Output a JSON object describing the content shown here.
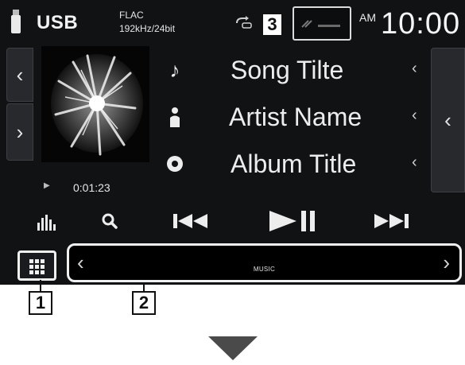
{
  "status": {
    "source": "USB",
    "format": "FLAC",
    "bitrate": "192kHz/24bit",
    "ampm": "AM",
    "clock": "10:00"
  },
  "track": {
    "song": "Song Tilte",
    "artist": "Artist Name",
    "album": "Album Title",
    "elapsed": "0:01:23"
  },
  "function_bar": {
    "label": "MUSIC"
  },
  "callouts": {
    "one": "1",
    "two": "2",
    "three": "3"
  },
  "icons": {
    "source": "usb-stick-icon",
    "repeat": "repeat-icon",
    "song": "music-note-icon",
    "artist": "artist-icon",
    "album": "album-disc-icon",
    "equalizer": "equalizer-icon",
    "search": "search-icon",
    "prev": "previous-track-icon",
    "play_pause": "play-pause-icon",
    "next": "next-track-icon",
    "menu": "menu-grid-icon",
    "down": "down-arrow-icon"
  },
  "colors": {
    "screen_bg": "#111214",
    "text": "#ededed",
    "tab_bg": "#27292d"
  }
}
